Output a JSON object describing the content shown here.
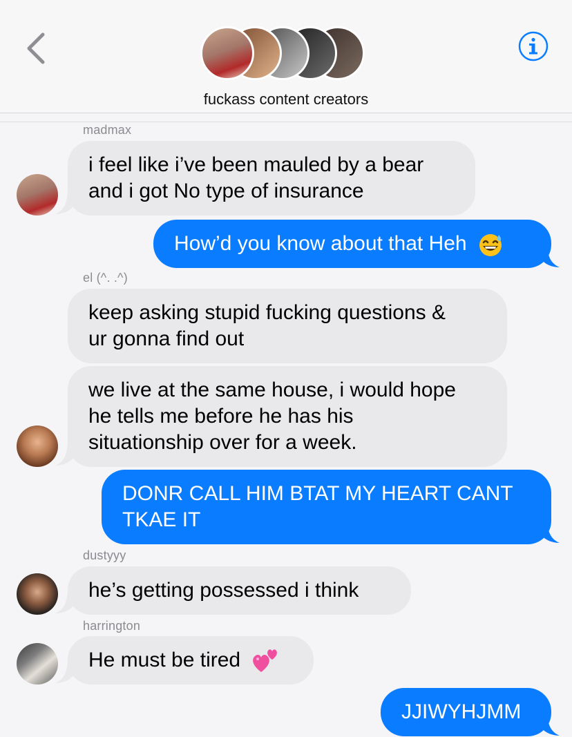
{
  "header": {
    "group_name": "fuckass content creators",
    "back_icon": "chevron-left-icon",
    "info_icon": "info-icon",
    "accent": "#0a7cff"
  },
  "messages": [
    {
      "sender": "madmax",
      "text_lines": [
        "i feel like i’ve been mauled by a bear",
        "and i got No type of insurance"
      ],
      "direction": "received"
    },
    {
      "text": "How’d you know about that Heh",
      "emoji": "grinning-sweat-emoji",
      "direction": "sent"
    },
    {
      "sender": "el (^. .^)",
      "text_lines": [
        "keep asking stupid fucking questions &",
        "ur gonna find out"
      ],
      "direction": "received"
    },
    {
      "text_lines": [
        "we live at the same house, i would hope",
        "he tells me before he has his",
        "situationship over for a week."
      ],
      "direction": "received"
    },
    {
      "text_lines": [
        "DONR CALL HIM BTAT MY HEART CANT",
        "TKAE IT"
      ],
      "direction": "sent"
    },
    {
      "sender": "dustyyy",
      "text": "he’s getting possessed i think",
      "direction": "received"
    },
    {
      "sender": "harrington",
      "text": "He must be tired",
      "emoji": "two-hearts-emoji",
      "direction": "received"
    },
    {
      "text": "JJIWYHJMM",
      "direction": "sent"
    }
  ],
  "colors": {
    "sent_bubble": "#0a7cff",
    "received_bubble": "#e9e9eb",
    "sender_label": "#8b8b90"
  }
}
